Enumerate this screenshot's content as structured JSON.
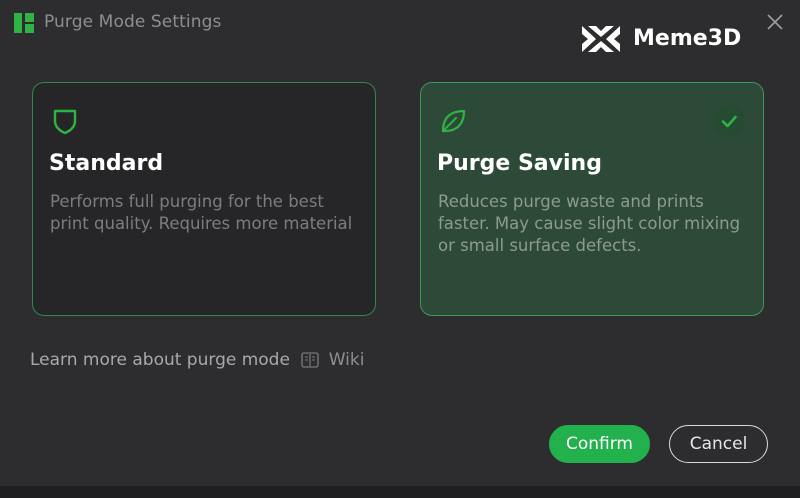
{
  "window": {
    "title": "Purge Mode Settings",
    "app_icon": "bambu-app-icon",
    "close_icon": "close-icon"
  },
  "brand": {
    "name": "Meme3D",
    "logo_icon": "meme3d-logo-icon"
  },
  "options": [
    {
      "id": "standard",
      "icon": "shield-icon",
      "title": "Standard",
      "description": "Performs full purging for the best print quality. Requires more material",
      "selected": false
    },
    {
      "id": "purge-saving",
      "icon": "leaf-icon",
      "title": "Purge Saving",
      "description": "Reduces purge waste and prints faster. May cause slight color mixing or small surface defects.",
      "selected": true
    }
  ],
  "learn_more": {
    "text": "Learn more about purge mode",
    "link_icon": "wiki-book-icon",
    "link_text": "Wiki"
  },
  "buttons": {
    "confirm": "Confirm",
    "cancel": "Cancel"
  },
  "colors": {
    "accent": "#22b14c",
    "card_border": "#2f8a4a",
    "selected_bg": "#2d4a39",
    "background": "#2d2d2f"
  }
}
